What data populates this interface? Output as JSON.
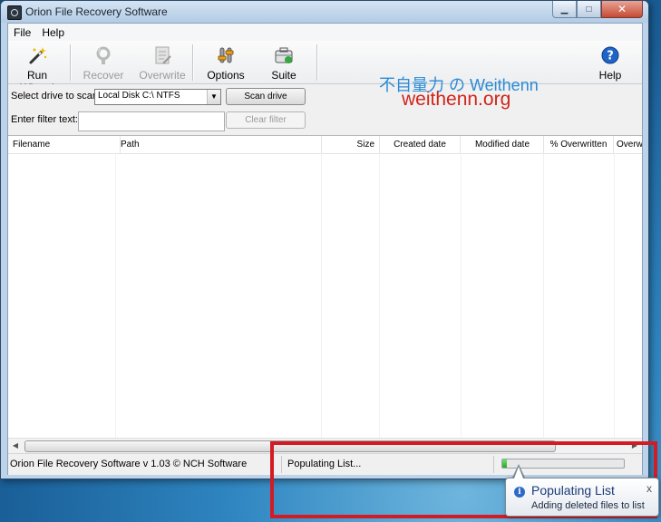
{
  "window": {
    "title": "Orion File Recovery Software"
  },
  "menu": {
    "file": "File",
    "help": "Help"
  },
  "toolbar": {
    "run_wizard": "Run Wizard",
    "recover": "Recover",
    "overwrite": "Overwrite",
    "options": "Options",
    "suite": "Suite",
    "help": "Help"
  },
  "controls": {
    "drive_label": "Select drive to scan:",
    "drive_value": "Local Disk C:\\ NTFS",
    "scan_button": "Scan drive",
    "filter_label": "Enter filter text:",
    "filter_value": "",
    "clear_button": "Clear filter"
  },
  "list": {
    "columns": [
      "Filename",
      "Path",
      "Size",
      "Created date",
      "Modified date",
      "% Overwritten",
      "Overw"
    ],
    "rows": []
  },
  "status": {
    "version": "Orion File Recovery Software v 1.03 © NCH Software",
    "message": "Populating List...",
    "progress": 0.04
  },
  "watermark": {
    "line1": "不自量力 の Weithenn",
    "line2": "weithenn.org"
  },
  "balloon": {
    "title": "Populating List",
    "text": "Adding deleted files to list",
    "close": "x"
  },
  "colors": {
    "highlight": "#d21b22",
    "progress": "#2ea62a",
    "watermark_blue": "#2a8bd6",
    "watermark_red": "#d0251c"
  },
  "icons": [
    "wand-icon",
    "recover-icon",
    "overwrite-icon",
    "options-icon",
    "suite-icon",
    "help-icon",
    "info-icon"
  ]
}
